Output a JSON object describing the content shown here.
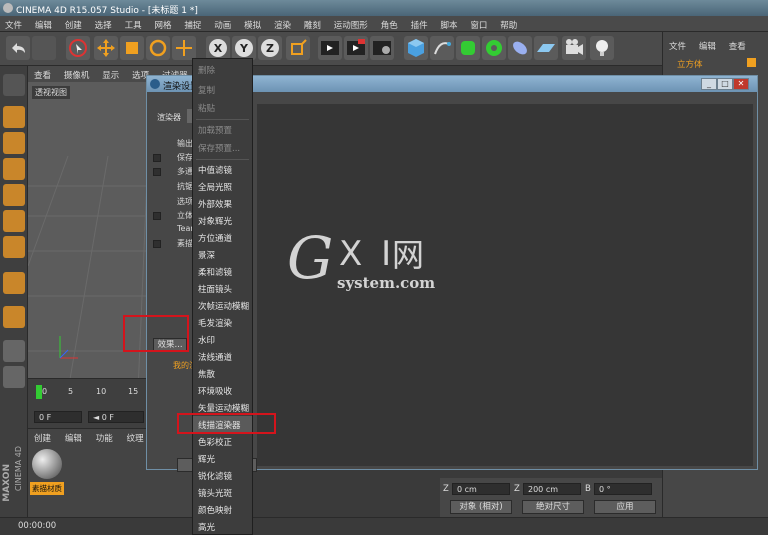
{
  "window": {
    "title": "CINEMA 4D R15.057 Studio - [未标题 1 *]"
  },
  "menubar": [
    "文件",
    "编辑",
    "创建",
    "选择",
    "工具",
    "网格",
    "捕捉",
    "动画",
    "模拟",
    "渲染",
    "雕刻",
    "运动图形",
    "角色",
    "插件",
    "脚本",
    "窗口",
    "帮助"
  ],
  "viewport": {
    "menu": [
      "查看",
      "摄像机",
      "显示",
      "选项",
      "过滤器"
    ],
    "label": "透视视图"
  },
  "right_panel": {
    "menu": [
      "文件",
      "编辑",
      "查看"
    ],
    "object_name": "立方体"
  },
  "dialog": {
    "title": "渲染设置",
    "renderer_label": "渲染器",
    "left_rows": [
      "输出",
      "保存",
      "多通道",
      "抗锯齿",
      "选项",
      "立体",
      "Team Render",
      "素描"
    ],
    "effect_button": "效果...",
    "preset_label": "我的渲染设置",
    "bottom_button": "渲染设置"
  },
  "context_menu": {
    "items": [
      {
        "label": "删除",
        "enabled": false
      },
      {
        "label": "复制",
        "enabled": false
      },
      {
        "label": "粘贴",
        "enabled": false
      },
      {
        "label": "加载预置",
        "enabled": false
      },
      {
        "label": "保存预置...",
        "enabled": false
      },
      {
        "label": "中值滤镜",
        "enabled": true
      },
      {
        "label": "全局光照",
        "enabled": true
      },
      {
        "label": "外部效果",
        "enabled": true
      },
      {
        "label": "对象辉光",
        "enabled": true
      },
      {
        "label": "方位通道",
        "enabled": true
      },
      {
        "label": "景深",
        "enabled": true
      },
      {
        "label": "柔和滤镜",
        "enabled": true
      },
      {
        "label": "柱面镜头",
        "enabled": true
      },
      {
        "label": "次帧运动模糊",
        "enabled": true
      },
      {
        "label": "毛发渲染",
        "enabled": true
      },
      {
        "label": "水印",
        "enabled": true
      },
      {
        "label": "法线通道",
        "enabled": true
      },
      {
        "label": "焦散",
        "enabled": true
      },
      {
        "label": "环境吸收",
        "enabled": true
      },
      {
        "label": "矢量运动模糊",
        "enabled": true
      },
      {
        "label": "线描渲染器",
        "enabled": true
      },
      {
        "label": "色彩校正",
        "enabled": true
      },
      {
        "label": "辉光",
        "enabled": true
      },
      {
        "label": "锐化滤镜",
        "enabled": true
      },
      {
        "label": "镜头光斑",
        "enabled": true
      },
      {
        "label": "颜色映射",
        "enabled": true
      },
      {
        "label": "高光",
        "enabled": true
      }
    ],
    "highlighted": "线描渲染器"
  },
  "timeline": {
    "ticks": [
      "0",
      "5",
      "10",
      "15"
    ],
    "frame_start": "0 F",
    "frame_field": "◄ 0 F"
  },
  "materials": {
    "menu": [
      "创建",
      "编辑",
      "功能",
      "纹理"
    ],
    "material_name": "素描材质"
  },
  "coords": {
    "z_label": "Z",
    "z_value": "0 cm",
    "z2_label": "Z",
    "z2_value": "200 cm",
    "b_label": "B",
    "b_value": "0 °",
    "mode": "对象 (相对)",
    "size": "绝对尺寸",
    "apply": "应用"
  },
  "status": {
    "time": "00:00:00"
  },
  "watermark": {
    "g": "G",
    "xi": "X I",
    "net": "网",
    "sys": "system.com"
  },
  "brand": {
    "maxon": "MAXON",
    "c4d": "CINEMA 4D"
  }
}
